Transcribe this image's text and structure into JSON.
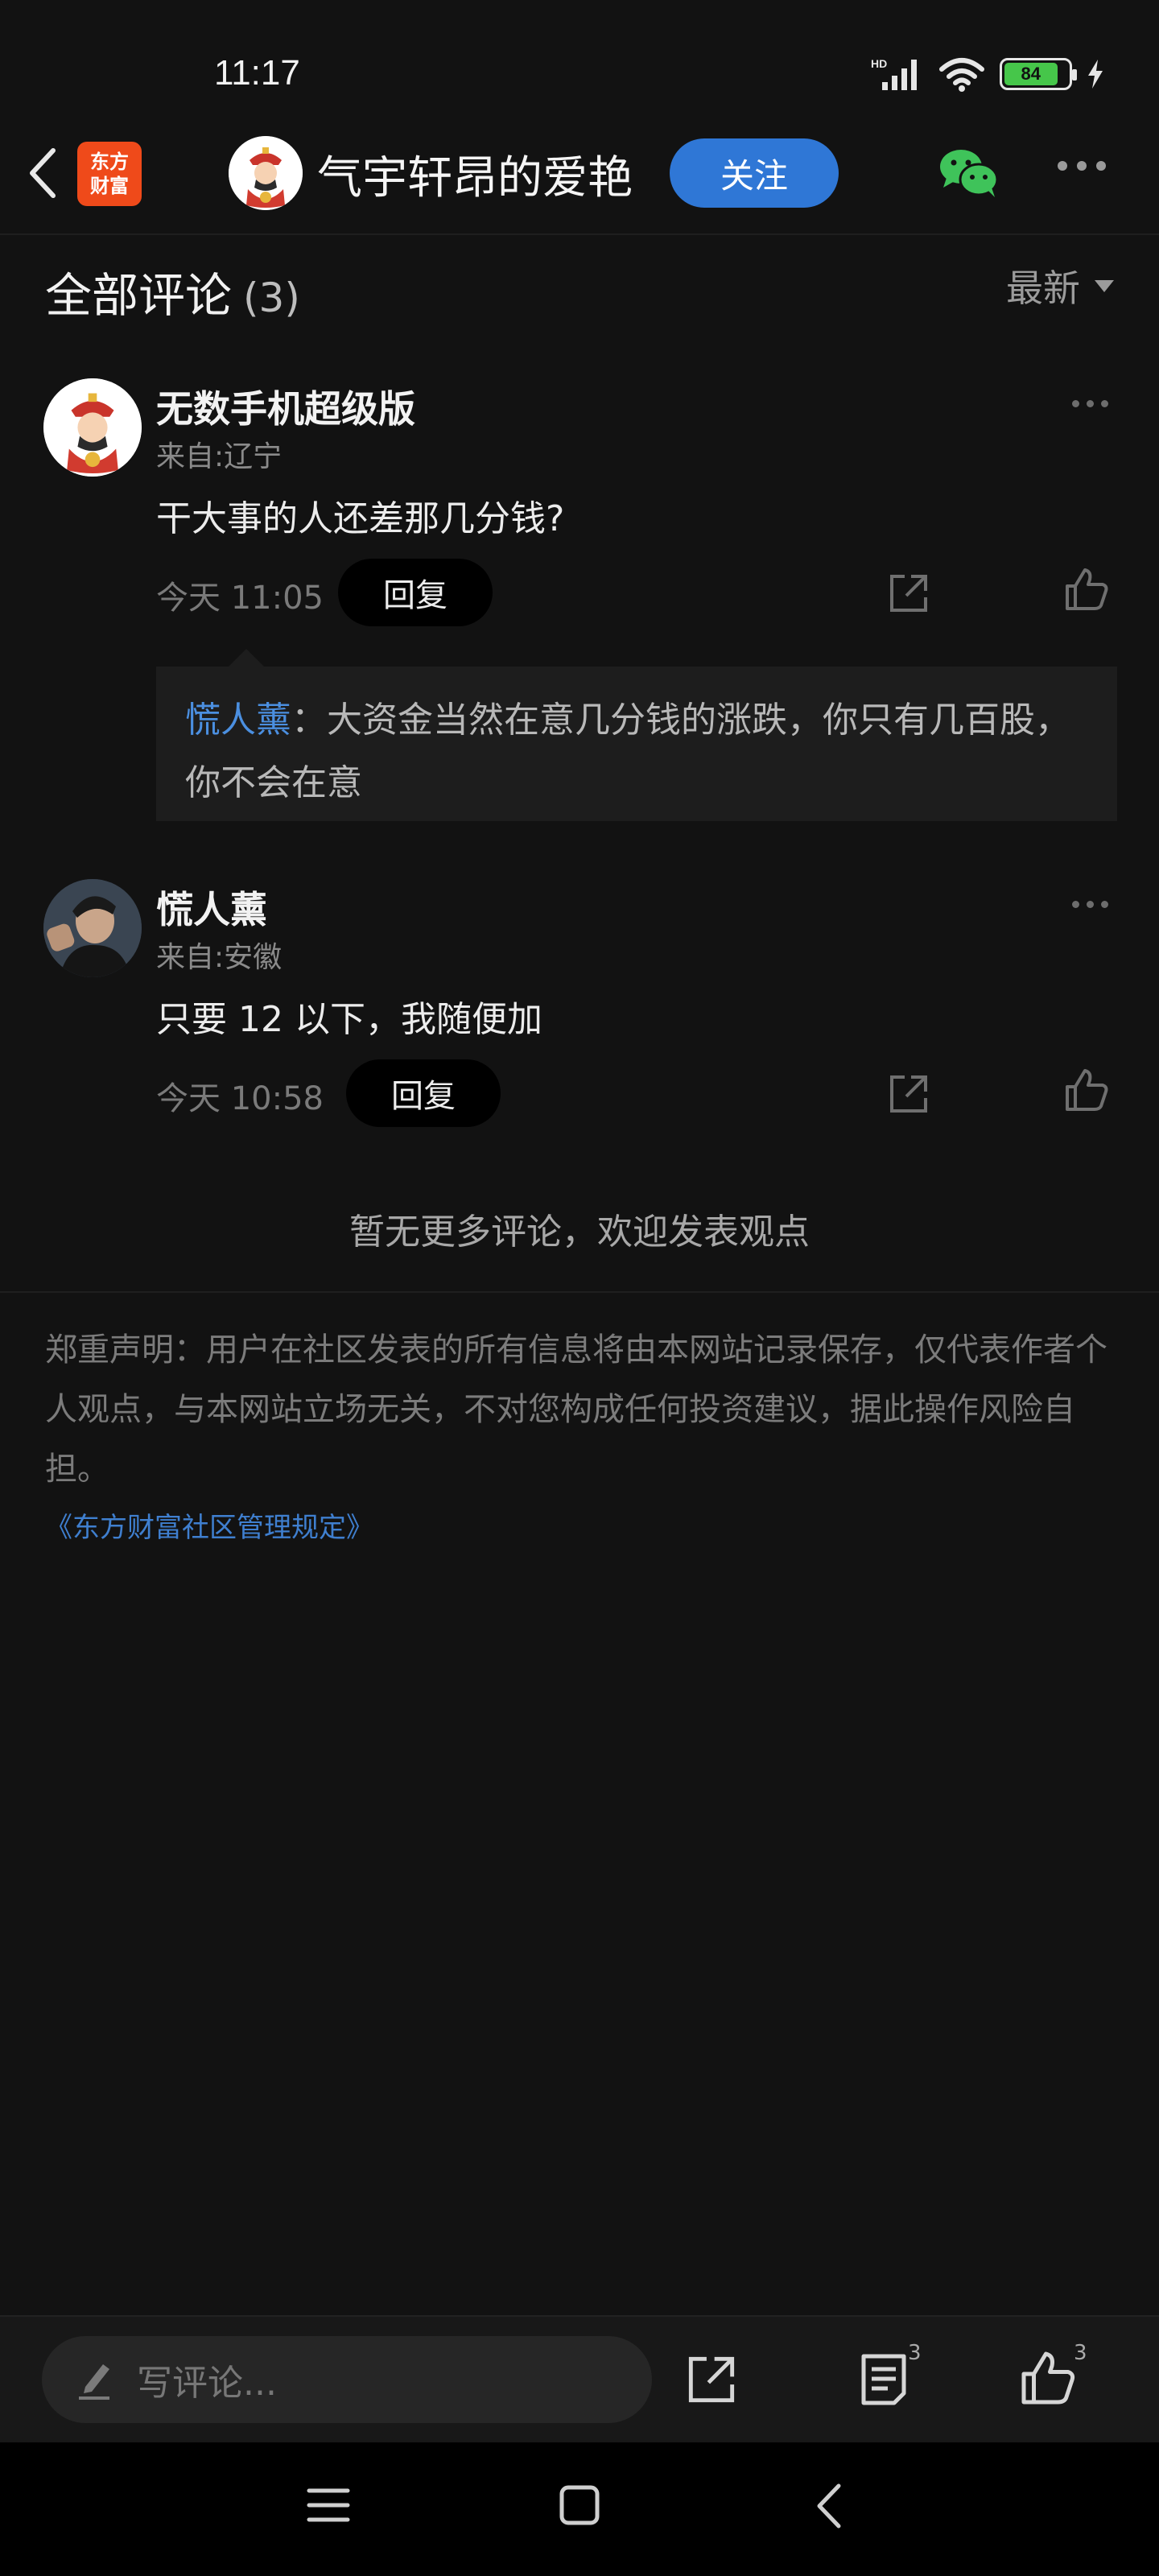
{
  "status_bar": {
    "time": "11:17",
    "network": "HD",
    "battery": "84"
  },
  "header": {
    "brand_logo": "东方\n财富",
    "author_name": "气宇轩昂的爱艳",
    "follow_label": "关注"
  },
  "section": {
    "title": "全部评论",
    "count": "(3)",
    "sort_label": "最新"
  },
  "comments": [
    {
      "user": "无数手机超级版",
      "location": "来自:辽宁",
      "text": "干大事的人还差那几分钱?",
      "time": "今天 11:05",
      "reply_label": "回复",
      "reply": {
        "user": "慌人薰",
        "text": "：大资金当然在意几分钱的涨跌，你只有几百股，你不会在意"
      }
    },
    {
      "user": "慌人薰",
      "location": "来自:安徽",
      "text": "只要 12 以下，我随便加",
      "time": "今天 10:58",
      "reply_label": "回复"
    }
  ],
  "no_more_text": "暂无更多评论，欢迎发表观点",
  "disclaimer": "郑重声明：用户在社区发表的所有信息将由本网站记录保存，仅代表作者个人观点，与本网站立场无关，不对您构成任何投资建议，据此操作风险自担。",
  "rules_link": "《东方财富社区管理规定》",
  "bottom_bar": {
    "input_placeholder": "写评论...",
    "comment_count": "3",
    "like_count": "3"
  },
  "colors": {
    "background": "#121212",
    "accent_blue": "#2f77d6",
    "link_blue": "#4b8fe0",
    "brand_orange": "#ef4a1a",
    "wechat_green": "#3fc35a"
  }
}
